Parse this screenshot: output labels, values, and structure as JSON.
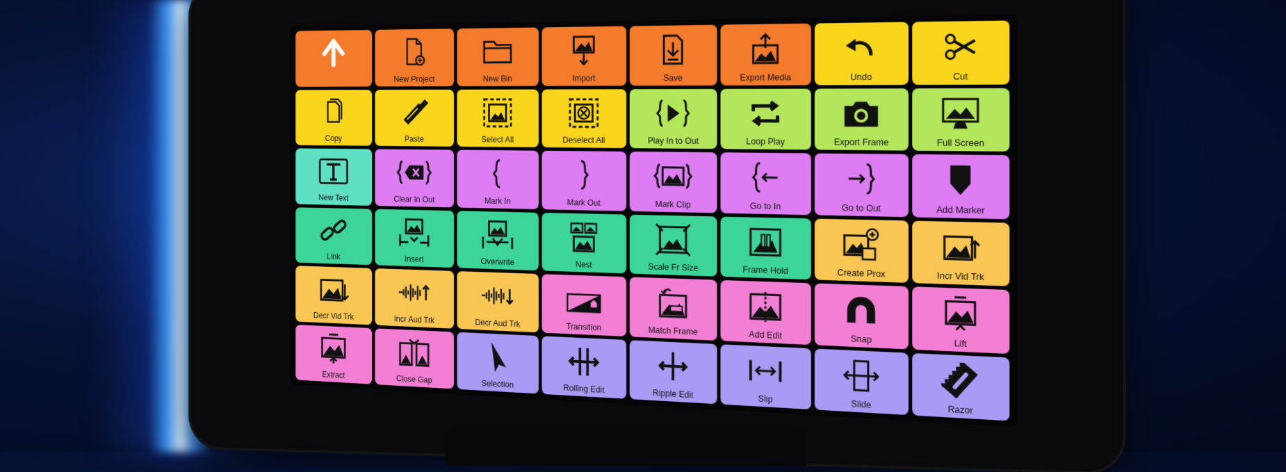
{
  "colors": {
    "orange": "#f47a2c",
    "yellow": "#f9d61b",
    "lime": "#b4e65c",
    "teal": "#5fe0c3",
    "purple": "#de7cf4",
    "green": "#3dd49a",
    "gold": "#f9c653",
    "pink": "#f27fd4",
    "lavender": "#a99bf5"
  },
  "keys": [
    {
      "label": "",
      "icon": "arrow-up-icon"
    },
    {
      "label": "New Project",
      "icon": "new-file-icon"
    },
    {
      "label": "New Bin",
      "icon": "folder-icon"
    },
    {
      "label": "Import",
      "icon": "import-image-icon"
    },
    {
      "label": "Save",
      "icon": "save-icon"
    },
    {
      "label": "Export Media",
      "icon": "export-image-icon"
    },
    {
      "label": "Undo",
      "icon": "undo-icon"
    },
    {
      "label": "Cut",
      "icon": "scissors-icon"
    },
    {
      "label": "Copy",
      "icon": "copy-icon"
    },
    {
      "label": "Paste",
      "icon": "glue-icon"
    },
    {
      "label": "Select All",
      "icon": "select-all-icon"
    },
    {
      "label": "Deselect All",
      "icon": "deselect-all-icon"
    },
    {
      "label": "Play In to Out",
      "icon": "play-in-out-icon"
    },
    {
      "label": "Loop Play",
      "icon": "loop-icon"
    },
    {
      "label": "Export Frame",
      "icon": "camera-icon"
    },
    {
      "label": "Full Screen",
      "icon": "monitor-icon"
    },
    {
      "label": "New Text",
      "icon": "text-icon"
    },
    {
      "label": "Clear In Out",
      "icon": "clear-in-out-icon"
    },
    {
      "label": "Mark In",
      "icon": "mark-in-icon"
    },
    {
      "label": "Mark Out",
      "icon": "mark-out-icon"
    },
    {
      "label": "Mark Clip",
      "icon": "mark-clip-icon"
    },
    {
      "label": "Go to In",
      "icon": "go-to-in-icon"
    },
    {
      "label": "Go to Out",
      "icon": "go-to-out-icon"
    },
    {
      "label": "Add Marker",
      "icon": "marker-icon"
    },
    {
      "label": "Link",
      "icon": "link-icon"
    },
    {
      "label": "Insert",
      "icon": "insert-icon"
    },
    {
      "label": "Overwrite",
      "icon": "overwrite-icon"
    },
    {
      "label": "Nest",
      "icon": "nest-icon"
    },
    {
      "label": "Scale Fr Size",
      "icon": "scale-icon"
    },
    {
      "label": "Frame Hold",
      "icon": "frame-hold-icon"
    },
    {
      "label": "Create Prox",
      "icon": "create-proxy-icon"
    },
    {
      "label": "Incr Vid Trk",
      "icon": "incr-video-icon"
    },
    {
      "label": "Decr Vid Trk",
      "icon": "decr-video-icon"
    },
    {
      "label": "Incr Aud Trk",
      "icon": "incr-audio-icon"
    },
    {
      "label": "Decr Aud Trk",
      "icon": "decr-audio-icon"
    },
    {
      "label": "Transition",
      "icon": "transition-icon"
    },
    {
      "label": "Match Frame",
      "icon": "match-frame-icon"
    },
    {
      "label": "Add Edit",
      "icon": "add-edit-icon"
    },
    {
      "label": "Snap",
      "icon": "magnet-icon"
    },
    {
      "label": "Lift",
      "icon": "lift-icon"
    },
    {
      "label": "Extract",
      "icon": "extract-icon"
    },
    {
      "label": "Close Gap",
      "icon": "close-gap-icon"
    },
    {
      "label": "Selection",
      "icon": "pointer-icon"
    },
    {
      "label": "Rolling Edit",
      "icon": "rolling-edit-icon"
    },
    {
      "label": "Ripple Edit",
      "icon": "ripple-edit-icon"
    },
    {
      "label": "Slip",
      "icon": "slip-icon"
    },
    {
      "label": "Slide",
      "icon": "slide-icon"
    },
    {
      "label": "Razor",
      "icon": "razor-icon"
    }
  ]
}
